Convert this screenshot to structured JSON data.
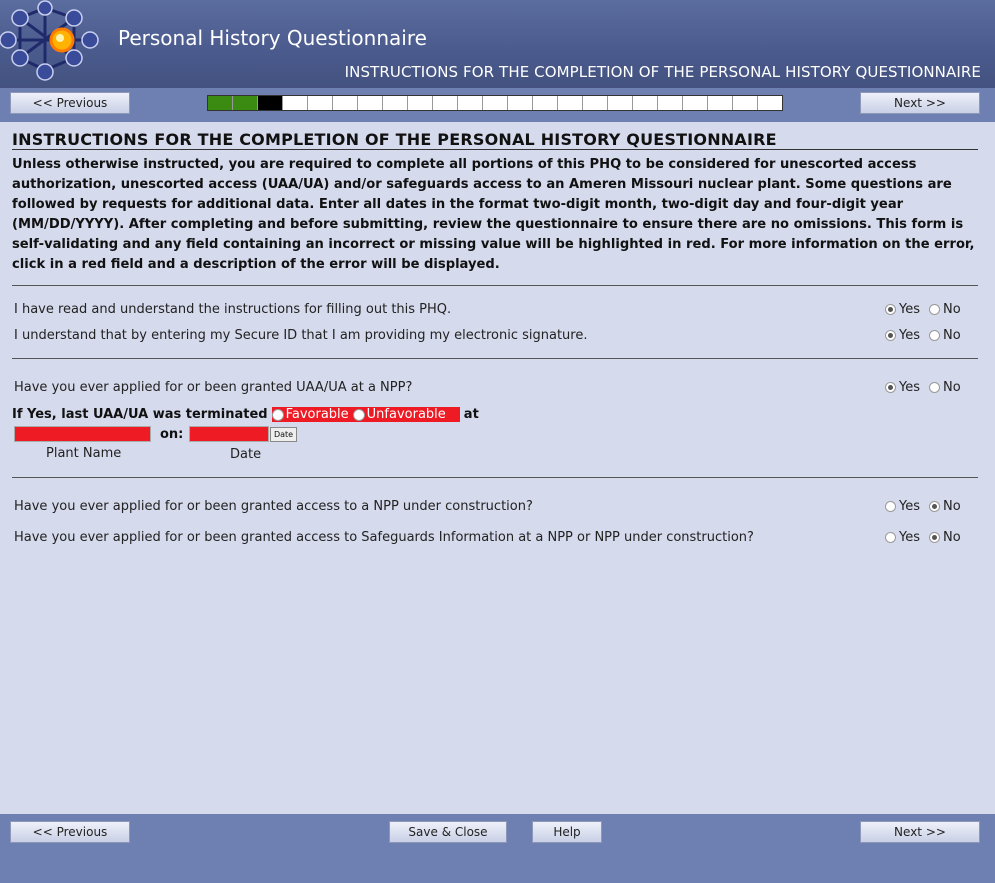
{
  "header": {
    "title": "Personal History Questionnaire",
    "subtitle": "INSTRUCTIONS FOR THE COMPLETION OF THE PERSONAL HISTORY QUESTIONNAIRE"
  },
  "nav": {
    "previous_label": "<< Previous",
    "next_label": "Next >>",
    "progress": {
      "total_steps": 23,
      "completed_steps": 2,
      "current_step": 3,
      "done_color": "#3b8a12",
      "current_color": "#000000"
    }
  },
  "page": {
    "title": "INSTRUCTIONS FOR THE COMPLETION OF THE PERSONAL HISTORY QUESTIONNAIRE",
    "instructions": "Unless otherwise instructed, you are required to complete all portions of this PHQ to be considered for unescorted access authorization, unescorted access (UAA/UA) and/or safeguards access to an Ameren Missouri nuclear plant. Some questions are followed by requests for additional data. Enter all dates in the format two-digit month, two-digit day and four-digit year (MM/DD/YYYY). After completing and before submitting, review the questionnaire to ensure there are no omissions. This form is self-validating and any field containing an incorrect or missing value will be highlighted in red. For more information on the error, click in a red field and a description of the error will be displayed."
  },
  "options": {
    "yes": "Yes",
    "no": "No"
  },
  "questions": {
    "read_instructions": {
      "text": "I have read and understand the instructions for filling out this PHQ.",
      "answer": "Yes"
    },
    "secure_id": {
      "text": "I understand that by entering my Secure ID that I am providing my electronic signature.",
      "answer": "Yes"
    },
    "applied_uaa": {
      "text": "Have you ever applied for or been granted UAA/UA at a NPP?",
      "answer": "Yes"
    },
    "npp_construction": {
      "text": "Have you ever applied for or been granted access to a NPP under construction?",
      "answer": "No"
    },
    "safeguards": {
      "text": "Have you ever applied for or been granted access to Safeguards Information at a NPP or NPP under construction?",
      "answer": "No"
    }
  },
  "termination": {
    "lead": "If Yes, last UAA/UA was terminated",
    "favorable": "Favorable",
    "unfavorable": "Unfavorable",
    "at": "at",
    "on": "on:",
    "date_button": "Date",
    "plant_caption": "Plant Name",
    "date_caption": "Date",
    "error_color": "#ee1b24"
  },
  "footer": {
    "save_label": "Save & Close",
    "help_label": "Help"
  }
}
